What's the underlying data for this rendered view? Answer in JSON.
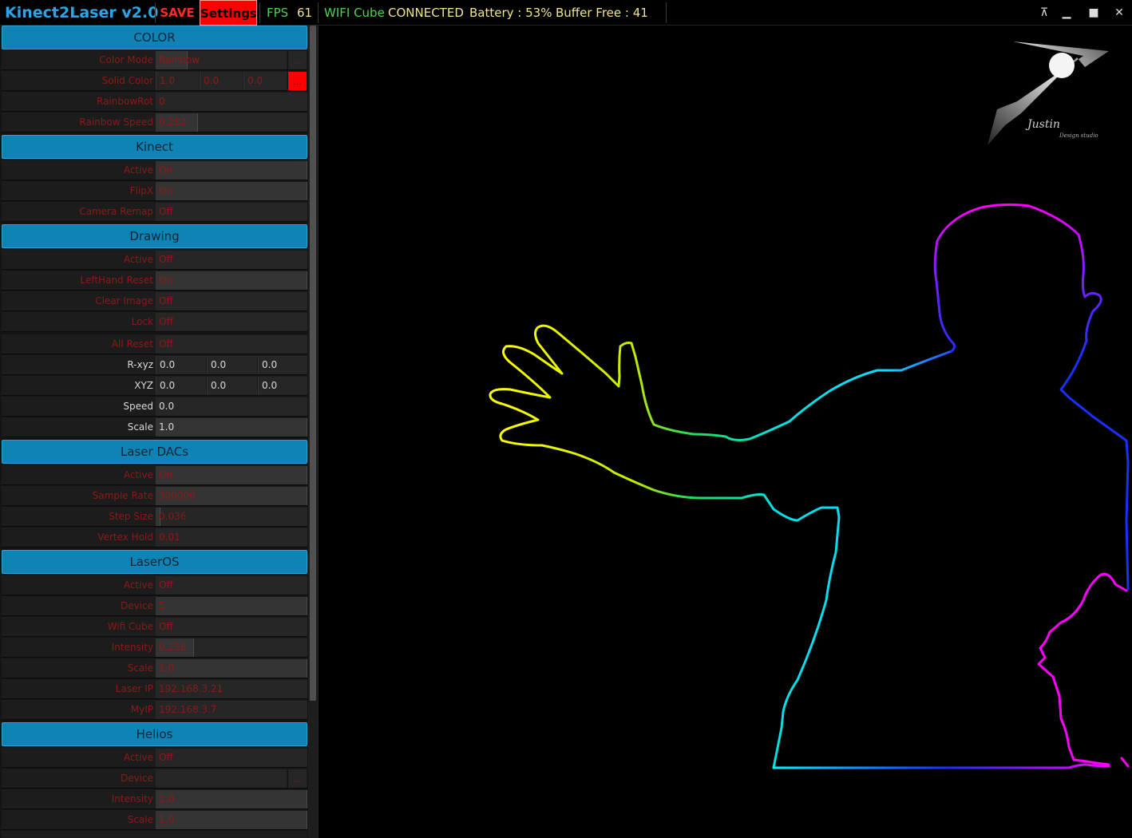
{
  "topbar": {
    "title": "Kinect2Laser v2.0",
    "save": "SAVE",
    "settings": "Settings",
    "fps_label": "FPS",
    "fps_value": "61",
    "wifi_label": "WIFI Cube",
    "wifi_status": "CONNECTED",
    "battery": "Battery : 53%",
    "buffer": "Buffer Free : 41",
    "minimize": "▁",
    "maximize": "■",
    "close": "✕",
    "pin": "⊼"
  },
  "color": {
    "header": "COLOR",
    "color_mode": {
      "label": "Color Mode",
      "value": "Rainbow"
    },
    "solid_color": {
      "label": "Solid Color",
      "r": "1.0",
      "g": "0.0",
      "b": "0.0",
      "btn": "..."
    },
    "rainbow_rot": {
      "label": "RainbowRot",
      "value": "0"
    },
    "rainbow_speed": {
      "label": "Rainbow Speed",
      "value": "0.282"
    }
  },
  "kinect": {
    "header": "Kinect",
    "active": {
      "label": "Active",
      "value": "On"
    },
    "flipx": {
      "label": "FlipX",
      "value": "On"
    },
    "camera_remap": {
      "label": "Camera Remap",
      "value": "Off"
    }
  },
  "drawing": {
    "header": "Drawing",
    "active": {
      "label": "Active",
      "value": "Off"
    },
    "lefthand_reset": {
      "label": "LeftHand Reset",
      "value": "On"
    },
    "clear_image": {
      "label": "Clear Image",
      "value": "Off"
    },
    "lock": {
      "label": "Lock",
      "value": "Off"
    },
    "all_reset": {
      "label": "All Reset",
      "value": "Off"
    },
    "rxyz": {
      "label": "R-xyz",
      "x": "0.0",
      "y": "0.0",
      "z": "0.0"
    },
    "xyz": {
      "label": "XYZ",
      "x": "0.0",
      "y": "0.0",
      "z": "0.0"
    },
    "speed": {
      "label": "Speed",
      "value": "0.0"
    },
    "scale": {
      "label": "Scale",
      "value": "1.0"
    }
  },
  "dacs": {
    "header": "Laser DACs",
    "active": {
      "label": "Active",
      "value": "On"
    },
    "sample_rate": {
      "label": "Sample Rate",
      "value": "300000"
    },
    "step_size": {
      "label": "Step Size",
      "value": "0.036"
    },
    "vertex_hold": {
      "label": "Vertex Hold",
      "value": "0.01"
    }
  },
  "laseros": {
    "header": "LaserOS",
    "active": {
      "label": "Active",
      "value": "Off"
    },
    "device": {
      "label": "Device",
      "value": "5"
    },
    "wifi_cube": {
      "label": "Wifi Cube",
      "value": "Off"
    },
    "intensity": {
      "label": "Intensity",
      "value": "0.256"
    },
    "scale": {
      "label": "Scale",
      "value": "1.0"
    },
    "laser_ip": {
      "label": "Laser IP",
      "value": "192.168.3.21"
    },
    "my_ip": {
      "label": "MyIP",
      "value": "192.168.3.7"
    }
  },
  "helios": {
    "header": "Helios",
    "active": {
      "label": "Active",
      "value": "Off"
    },
    "device": {
      "label": "Device",
      "value": ""
    },
    "intensity": {
      "label": "Intensity",
      "value": "1.0"
    },
    "scale": {
      "label": "Scale",
      "value": "1.0"
    }
  },
  "logo": {
    "signature": "Justin",
    "subtitle": "Design studio"
  },
  "colors": {
    "accent": "#1083b6",
    "danger": "#ff0000",
    "label_red": "#8a1a1a"
  }
}
